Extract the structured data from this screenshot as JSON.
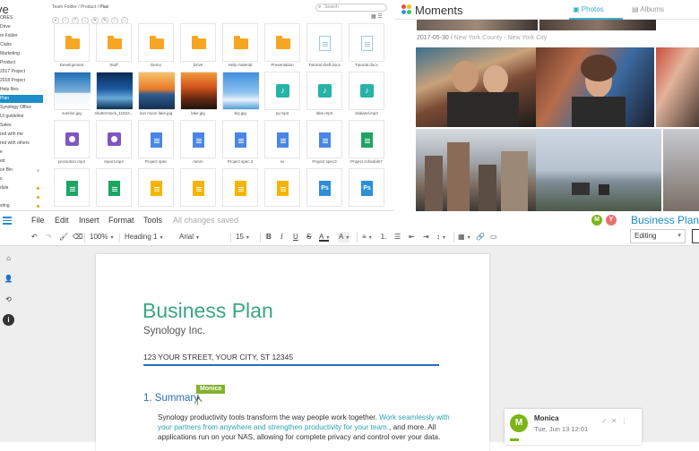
{
  "drive": {
    "app_title": "ve",
    "breadcrumb": [
      "Team Folder",
      "Product",
      "Plan"
    ],
    "search_placeholder": "Search",
    "sidebar": [
      {
        "label": "ORES",
        "active": false
      },
      {
        "label": "Drive",
        "active": false
      },
      {
        "label": "m Folder",
        "active": false
      },
      {
        "label": "Clubs",
        "active": false
      },
      {
        "label": "Marketing",
        "active": false
      },
      {
        "label": "Product",
        "active": false
      },
      {
        "label": "2017 Project",
        "active": false
      },
      {
        "label": "2018 Project",
        "active": false
      },
      {
        "label": "Help files",
        "active": false
      },
      {
        "label": "Plan",
        "active": true
      },
      {
        "label": "Synology Office",
        "active": false
      },
      {
        "label": "UI guideline",
        "active": false
      },
      {
        "label": "Sales",
        "active": false
      },
      {
        "label": "red with me",
        "active": false
      },
      {
        "label": "red with others",
        "active": false
      },
      {
        "label": "e",
        "active": false
      },
      {
        "label": "ed",
        "active": false
      },
      {
        "label": "ce Bin",
        "active": false
      },
      {
        "label": "s",
        "active": false
      },
      {
        "label": "dule",
        "active": false
      },
      {
        "label": "",
        "active": false
      },
      {
        "label": "sting",
        "active": false
      }
    ],
    "files": [
      {
        "name": "Development",
        "kind": "folder"
      },
      {
        "name": "Stuff",
        "kind": "folder"
      },
      {
        "name": "Demo",
        "kind": "folder"
      },
      {
        "name": "Drive",
        "kind": "folder"
      },
      {
        "name": "Help material",
        "kind": "folder"
      },
      {
        "name": "Presentation",
        "kind": "folder"
      },
      {
        "name": "Tutorial draft.docx",
        "kind": "doc-white"
      },
      {
        "name": "Tutorial.docx",
        "kind": "doc-white"
      },
      {
        "name": "sunrise.jpg",
        "kind": "photo",
        "palette": "ski"
      },
      {
        "name": "shutterstock_11822...",
        "kind": "photo",
        "palette": "blue"
      },
      {
        "name": "sun moon lake.jpg",
        "kind": "photo",
        "palette": "sunset"
      },
      {
        "name": "lake.jpg",
        "kind": "photo",
        "palette": "orange"
      },
      {
        "name": "sky.jpg",
        "kind": "photo",
        "palette": "sky"
      },
      {
        "name": "yy.mp3",
        "kind": "audio"
      },
      {
        "name": "lake.mp3",
        "kind": "audio"
      },
      {
        "name": "skaland.mp3",
        "kind": "audio"
      },
      {
        "name": "promotion.mp4",
        "kind": "video"
      },
      {
        "name": "report.mp4",
        "kind": "video"
      },
      {
        "name": "Project spec",
        "kind": "doc-blue"
      },
      {
        "name": "mmm",
        "kind": "doc-blue"
      },
      {
        "name": "Project spec 2",
        "kind": "doc-blue"
      },
      {
        "name": "sx",
        "kind": "doc-blue"
      },
      {
        "name": "Project spec3",
        "kind": "doc-blue"
      },
      {
        "name": "Project schedule7",
        "kind": "doc-green"
      },
      {
        "name": "",
        "kind": "doc-green"
      },
      {
        "name": "",
        "kind": "doc-green"
      },
      {
        "name": "",
        "kind": "doc-yellow"
      },
      {
        "name": "",
        "kind": "doc-yellow"
      },
      {
        "name": "",
        "kind": "doc-yellow"
      },
      {
        "name": "",
        "kind": "doc-yellow"
      },
      {
        "name": "",
        "kind": "doc-ps"
      },
      {
        "name": "",
        "kind": "doc-ps"
      }
    ]
  },
  "moments": {
    "title": "Moments",
    "tabs": [
      "Photos",
      "Albums"
    ],
    "date": "2017-05-30",
    "location": "New York County - New York City"
  },
  "office": {
    "menu": [
      "File",
      "Edit",
      "Insert",
      "Format",
      "Tools"
    ],
    "save_status": "All changes saved",
    "collaborators": [
      {
        "initial": "M",
        "color": "#7cb518"
      },
      {
        "initial": "Y",
        "color": "#e57373"
      }
    ],
    "doc_title": "Business Plan",
    "toolbar": {
      "zoom": "100%",
      "style": "Heading 1",
      "font": "Arial",
      "size": "15",
      "ps_label": "Ps"
    },
    "mode": "Editing",
    "document": {
      "heading": "Business Plan",
      "company": "Synology Inc.",
      "address": "123 YOUR STREET, YOUR CITY, ST 12345",
      "section": "1. Summary",
      "cursor_user": "Monica",
      "para_lead": "Synology productivity tools transform the way people work together. ",
      "para_highlight": "Work seamlessly with your partners from anywhere and strengthen productivity for your team.",
      "para_rest": ", and more. All applications run on your NAS, allowing for complete privacy and control over your data."
    },
    "comment": {
      "author": "Monica",
      "initial": "M",
      "time": "Tue, Jun 13 12:01"
    }
  }
}
